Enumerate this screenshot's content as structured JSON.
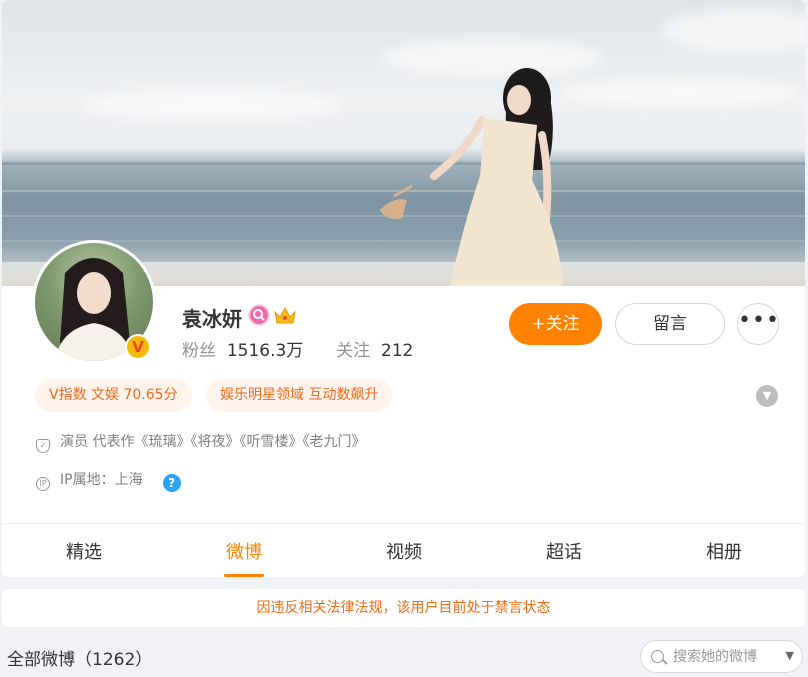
{
  "profile": {
    "name": "袁冰妍",
    "verified_mark": "V",
    "stats": {
      "followers_label": "粉丝",
      "followers_value": "1516.3万",
      "following_label": "关注",
      "following_value": "212"
    }
  },
  "actions": {
    "follow_label": "+关注",
    "message_label": "留言",
    "more_label": "•••"
  },
  "tags": [
    "V指数 文娱 70.65分",
    "娱乐明星领域 互动数飙升"
  ],
  "info": {
    "description": "演员 代表作《琉璃》《将夜》《听雪楼》《老九门》",
    "ip": "IP属地：上海",
    "help": "?"
  },
  "tabs": [
    {
      "label": "精选"
    },
    {
      "label": "微博"
    },
    {
      "label": "视频"
    },
    {
      "label": "超话"
    },
    {
      "label": "相册"
    }
  ],
  "active_tab": "微博",
  "notice": "因违反相关法律法规，该用户目前处于禁言状态",
  "feed": {
    "title": "全部微博（1262）",
    "search_placeholder": "搜索她的微博"
  },
  "colors": {
    "accent": "#ff8200",
    "tag_bg": "#fff3eb",
    "tag_text": "#e86b1f",
    "notice_text": "#ef6c16",
    "help_icon": "#2aa4f4"
  },
  "icons": {
    "follow_button": "plus-icon",
    "more_button": "more-dots-icon",
    "expand": "chevron-down-icon",
    "description": "shield-icon",
    "ip": "ip-location-icon",
    "help": "question-icon",
    "search": "search-icon",
    "search_dropdown": "caret-down-icon",
    "badge_1": "pink-magnifier-badge-icon",
    "badge_2": "crown-badge-icon"
  }
}
